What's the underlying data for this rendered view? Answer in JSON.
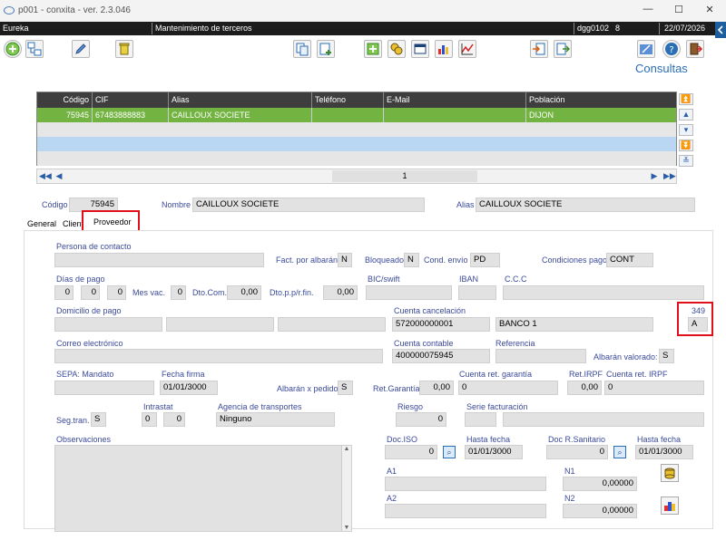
{
  "window": {
    "title": "p001 - conxita - ver. 2.3.046",
    "min": "—",
    "max": "☐",
    "close": "✕"
  },
  "statusbar": {
    "app": "Eureka",
    "screen": "Mantenimiento de terceros",
    "user": "dgg0102",
    "num": "8",
    "date": "22/07/2026"
  },
  "toolbar": {
    "consultas": "Consultas"
  },
  "grid": {
    "headers": [
      "Código",
      "CIF",
      "Alias",
      "Teléfono",
      "E-Mail",
      "Población"
    ],
    "rows": [
      {
        "codigo": "75945",
        "cif": "67483888883",
        "alias": "CAILLOUX SOCIETE",
        "telefono": "",
        "email": "",
        "poblacion": "DIJON"
      }
    ],
    "page": "1"
  },
  "header": {
    "codigo_label": "Código",
    "codigo": "75945",
    "nombre_label": "Nombre",
    "nombre": "CAILLOUX SOCIETE",
    "alias_label": "Alias",
    "alias": "CAILLOUX SOCIETE"
  },
  "tabs": [
    "General",
    "Cliente",
    "Proveedor"
  ],
  "form": {
    "persona_contacto": "Persona de contacto",
    "fact_albaran": "Fact. por albarán",
    "fact_albaran_v": "N",
    "bloqueado": "Bloqueado",
    "bloqueado_v": "N",
    "cond_envio": "Cond. envío",
    "cond_envio_v": "PD",
    "cond_pago": "Condiciones pago",
    "cond_pago_v": "CONT",
    "dias_pago": "Días de pago",
    "dia1": "0",
    "dia2": "0",
    "dia3": "0",
    "mes_vac": "Mes vac.",
    "mes_vac_v": "0",
    "dto_com": "Dto.Com.",
    "dto_com_v": "0,00",
    "dto_pp": "Dto.p.p/r.fin.",
    "dto_pp_v": "0,00",
    "bic": "BIC/swift",
    "iban": "IBAN",
    "ccc": "C.C.C",
    "domicilio": "Domicilio de pago",
    "cuenta_canc": "Cuenta cancelación",
    "cuenta_canc_v": "572000000001",
    "banco": "BANCO 1",
    "m349": "349",
    "m349_v": "A",
    "correo": "Correo electrónico",
    "cuenta_contable": "Cuenta contable",
    "cuenta_contable_v": "400000075945",
    "referencia": "Referencia",
    "albaran_valorado": "Albarán valorado:",
    "albaran_valorado_v": "S",
    "sepa": "SEPA: Mandato",
    "fecha_firma": "Fecha firma",
    "fecha_firma_v": "01/01/3000",
    "albaran_pedido": "Albarán x pedido",
    "albaran_pedido_v": "S",
    "ret_garantia": "Ret.Garantía",
    "ret_garantia_v": "0,00",
    "cuenta_ret_gar": "Cuenta ret. garantía",
    "cuenta_ret_gar_v": "0",
    "ret_irpf": "Ret.IRPF",
    "ret_irpf_v": "0,00",
    "cuenta_ret_irpf": "Cuenta ret. IRPF",
    "cuenta_ret_irpf_v": "0",
    "intrastat": "Intrastat",
    "intra1": "0",
    "intra2": "0",
    "agencia": "Agencia de transportes",
    "agencia_v": "Ninguno",
    "seg_tran": "Seg.tran.",
    "seg_tran_v": "S",
    "riesgo": "Riesgo",
    "riesgo_v": "0",
    "serie_fact": "Serie facturación",
    "observaciones": "Observaciones",
    "doc_iso": "Doc.ISO",
    "doc_iso_v": "0",
    "hasta_fecha": "Hasta fecha",
    "hasta_fecha_v": "01/01/3000",
    "doc_r_sanitario": "Doc R.Sanitario",
    "doc_r_sanitario_v": "0",
    "hasta_fecha2": "Hasta fecha",
    "hasta_fecha2_v": "01/01/3000",
    "a1": "A1",
    "n1": "N1",
    "n1_v": "0,00000",
    "a2": "A2",
    "n2": "N2",
    "n2_v": "0,00000"
  }
}
